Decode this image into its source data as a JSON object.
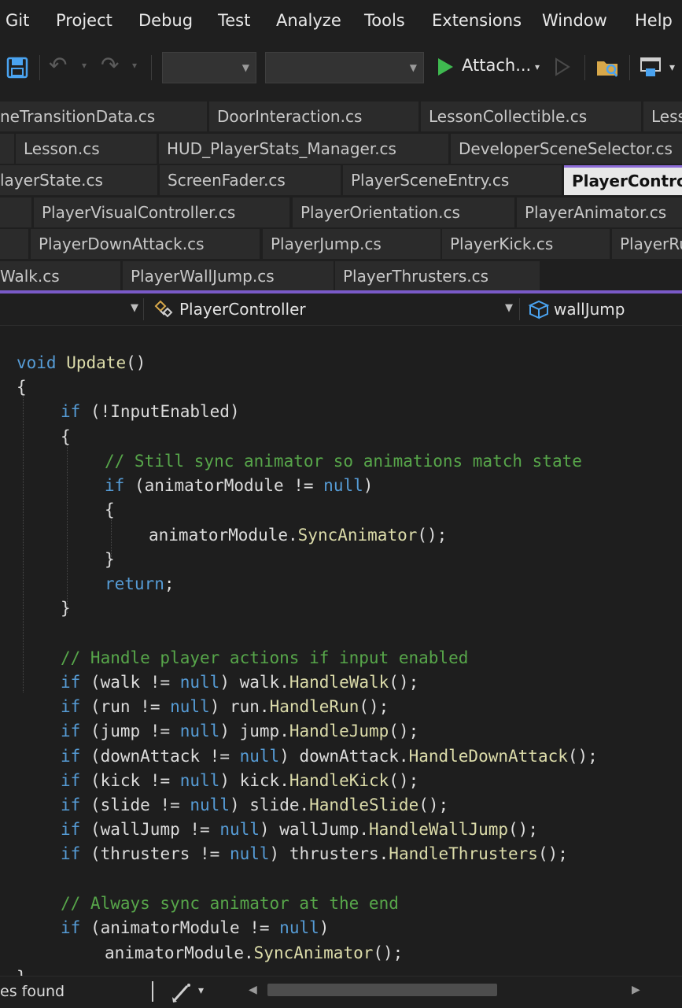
{
  "menu": [
    "Git",
    "Project",
    "Debug",
    "Test",
    "Analyze",
    "Tools",
    "Extensions",
    "Window",
    "Help"
  ],
  "toolbar": {
    "attach_label": "Attach...",
    "config_value": "",
    "platform_value": ""
  },
  "tabs": {
    "row1": [
      "neTransitionData.cs",
      "DoorInteraction.cs",
      "LessonCollectible.cs",
      "Less"
    ],
    "row2": [
      "Lesson.cs",
      "HUD_PlayerStats_Manager.cs",
      "DeveloperSceneSelector.cs"
    ],
    "row3": [
      "layerState.cs",
      "ScreenFader.cs",
      "PlayerSceneEntry.cs",
      "PlayerControll"
    ],
    "row4": [
      "PlayerVisualController.cs",
      "PlayerOrientation.cs",
      "PlayerAnimator.cs"
    ],
    "row5": [
      "PlayerDownAttack.cs",
      "PlayerJump.cs",
      "PlayerKick.cs",
      "PlayerRu"
    ],
    "row6": [
      "Walk.cs",
      "PlayerWallJump.cs",
      "PlayerThrusters.cs"
    ]
  },
  "nav": {
    "type_label": "PlayerController",
    "member_label": "wallJump"
  },
  "status": {
    "issues_text": "es found"
  },
  "code": {
    "l1a": "void",
    "l1b": "Update",
    "l1c": "()",
    "l2": "{",
    "l3a": "if",
    "l3b": " (!InputEnabled)",
    "l4": "{",
    "l5": "// Still sync animator so animations match state",
    "l6a": "if",
    "l6b": " (animatorModule != ",
    "l6c": "null",
    "l6d": ")",
    "l7": "{",
    "l8a": "animatorModule.",
    "l8b": "SyncAnimator",
    "l8c": "();",
    "l9": "}",
    "l10a": "return",
    "l10b": ";",
    "l11": "}",
    "l12": "// Handle player actions if input enabled",
    "actions": [
      {
        "v": "walk",
        "m": "HandleWalk"
      },
      {
        "v": "run",
        "m": "HandleRun"
      },
      {
        "v": "jump",
        "m": "HandleJump"
      },
      {
        "v": "downAttack",
        "m": "HandleDownAttack"
      },
      {
        "v": "kick",
        "m": "HandleKick"
      },
      {
        "v": "slide",
        "m": "HandleSlide"
      },
      {
        "v": "wallJump",
        "m": "HandleWallJump"
      },
      {
        "v": "thrusters",
        "m": "HandleThrusters"
      }
    ],
    "l21": "// Always sync animator at the end",
    "l22a": "if",
    "l22b": " (animatorModule != ",
    "l22c": "null",
    "l22d": ")",
    "l23a": "animatorModule.",
    "l23b": "SyncAnimator",
    "l23c": "();",
    "kw_if": "if",
    "kw_null": "null"
  }
}
